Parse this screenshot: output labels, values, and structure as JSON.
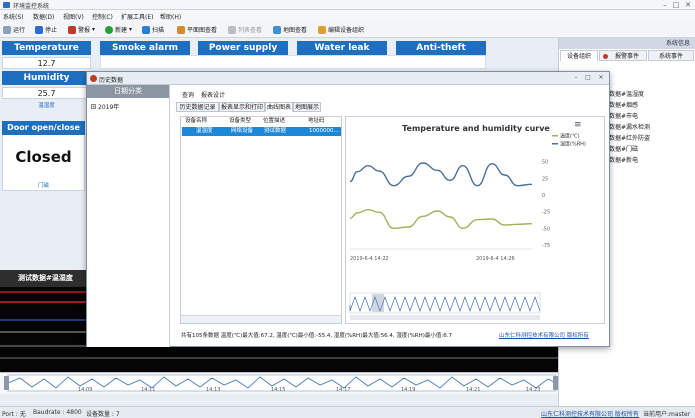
{
  "app": {
    "title": "环境监控系统",
    "menu": [
      "系统(S)",
      "数据(D)",
      "视图(V)",
      "控制(C)",
      "扩展工具(E)",
      "帮助(H)"
    ],
    "toolbar": {
      "run": "运行",
      "stop": "停止",
      "alarm": "警报",
      "new": "新建",
      "scan": "扫描",
      "plan_view": "平面图查看",
      "list_view": "列表查看",
      "map_view": "地图查看",
      "edit_org": "编辑设备组织"
    }
  },
  "sensors": {
    "temperature": {
      "label": "Temperature",
      "value": "12.7"
    },
    "humidity": {
      "label": "Humidity",
      "value": "25.7",
      "sub": "温湿度"
    },
    "smoke": {
      "label": "Smoke alarm"
    },
    "power": {
      "label": "Power supply"
    },
    "water": {
      "label": "Water leak"
    },
    "theft": {
      "label": "Anti-theft"
    },
    "door": {
      "label": "Door open/close",
      "state": "Closed",
      "sub": "门磁"
    }
  },
  "right_panel": {
    "title": "系统信息",
    "tabs": [
      "设备组织",
      "报警事件",
      "系统事件"
    ],
    "tree": [
      "试数据#温湿度",
      "试数据#烟感",
      "试数据#市电",
      "试数据#漏水检测",
      "试数据#红外防盗",
      "试数据#门磁",
      "试数据#新电"
    ]
  },
  "dark_strip_label": "测试数据#温湿度",
  "dialog": {
    "title": "历史数据",
    "left_header": "日期分类",
    "tree_year": "2019年",
    "top_menu": [
      "查询",
      "报表设计"
    ],
    "tabs": [
      "历史数据记录",
      "报表显示和打印",
      "曲线图表",
      "地图展示"
    ],
    "grid": {
      "columns": [
        "设备名称",
        "设备类型",
        "位置描述",
        "地址码"
      ],
      "row": [
        "温湿度",
        "网络设备",
        "测试数据",
        "1000000..."
      ]
    },
    "footer": {
      "summary": "共有105条数据  温度(℃)最大值:67.2,  温度(℃)最小值:-55.4,  湿度(%RH)最大值:56.4,  湿度(%RH)最小值:6.7",
      "company": "山东仁科测控技术有限公司 版权所有"
    }
  },
  "chart_data": {
    "type": "line",
    "title": "Temperature and humidity curve",
    "series": [
      {
        "name": "温度(℃)",
        "color": "#a7ad5a",
        "x": [
          0,
          0.04,
          0.1,
          0.16,
          0.24,
          0.32,
          0.4,
          0.48,
          0.55,
          0.62,
          0.7,
          0.78,
          0.85,
          0.92,
          1.0
        ],
        "values": [
          -35,
          -27,
          -22,
          -26,
          -50,
          -48,
          -32,
          -24,
          -33,
          -50,
          -37,
          -36,
          -45,
          -44,
          -43
        ]
      },
      {
        "name": "湿度(%RH)",
        "color": "#4a6f9c",
        "x": [
          0,
          0.04,
          0.1,
          0.16,
          0.24,
          0.32,
          0.4,
          0.48,
          0.55,
          0.62,
          0.7,
          0.78,
          0.85,
          0.92,
          1.0
        ],
        "values": [
          20,
          35,
          44,
          36,
          14,
          28,
          48,
          37,
          22,
          44,
          14,
          47,
          30,
          14,
          16
        ]
      }
    ],
    "x_ticks": [
      "2019-6-4 14:22",
      "2019-6-4 14:26"
    ],
    "y_ticks": [
      50,
      25,
      0,
      -25,
      -50,
      -75
    ],
    "ylim": [
      -75,
      60
    ],
    "legend": "top-right"
  },
  "timeline": {
    "ticks": [
      "14:09",
      "14:11",
      "14:13",
      "14:15",
      "14:17",
      "14:19",
      "14:21",
      "14:23"
    ]
  },
  "status": {
    "port": "Port : 无",
    "baudrate": "Baudrate : 4800",
    "count": "设备数量 : 7",
    "company": "山东仁科测控技术有限公司 版权所有",
    "user": "当前用户:master"
  }
}
